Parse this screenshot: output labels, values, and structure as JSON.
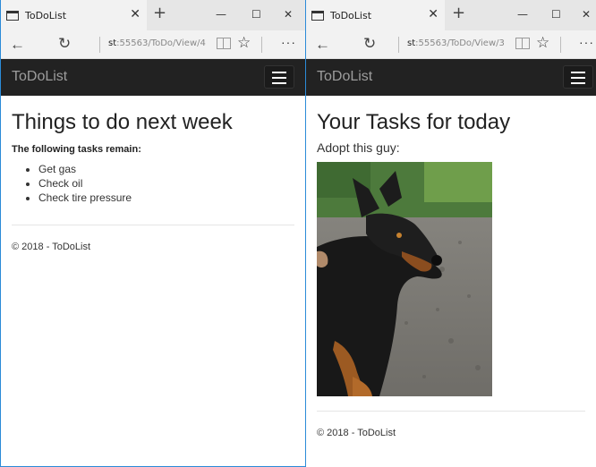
{
  "left": {
    "tab_title": "ToDoList",
    "url_prefix": "st",
    "url_rest": ":55563/ToDo/View/4",
    "brand": "ToDoList",
    "heading": "Things to do next week",
    "subtitle": "The following tasks remain:",
    "tasks": [
      "Get gas",
      "Check oil",
      "Check tire pressure"
    ],
    "footer": "© 2018 - ToDoList"
  },
  "right": {
    "tab_title": "ToDoList",
    "url_prefix": "st",
    "url_rest": ":55563/ToDo/View/3",
    "brand": "ToDoList",
    "heading": "Your Tasks for today",
    "subtitle": "Adopt this guy:",
    "footer": "© 2018 - ToDoList"
  },
  "glyphs": {
    "close": "✕",
    "new_tab": "+",
    "minimize": "—",
    "maximize": "☐",
    "back": "←",
    "refresh": "↻",
    "star": "☆",
    "more": "···"
  },
  "colors": {
    "navbar": "#222222",
    "brand_text": "#9d9d9d",
    "window_border": "#2b8bd8"
  }
}
